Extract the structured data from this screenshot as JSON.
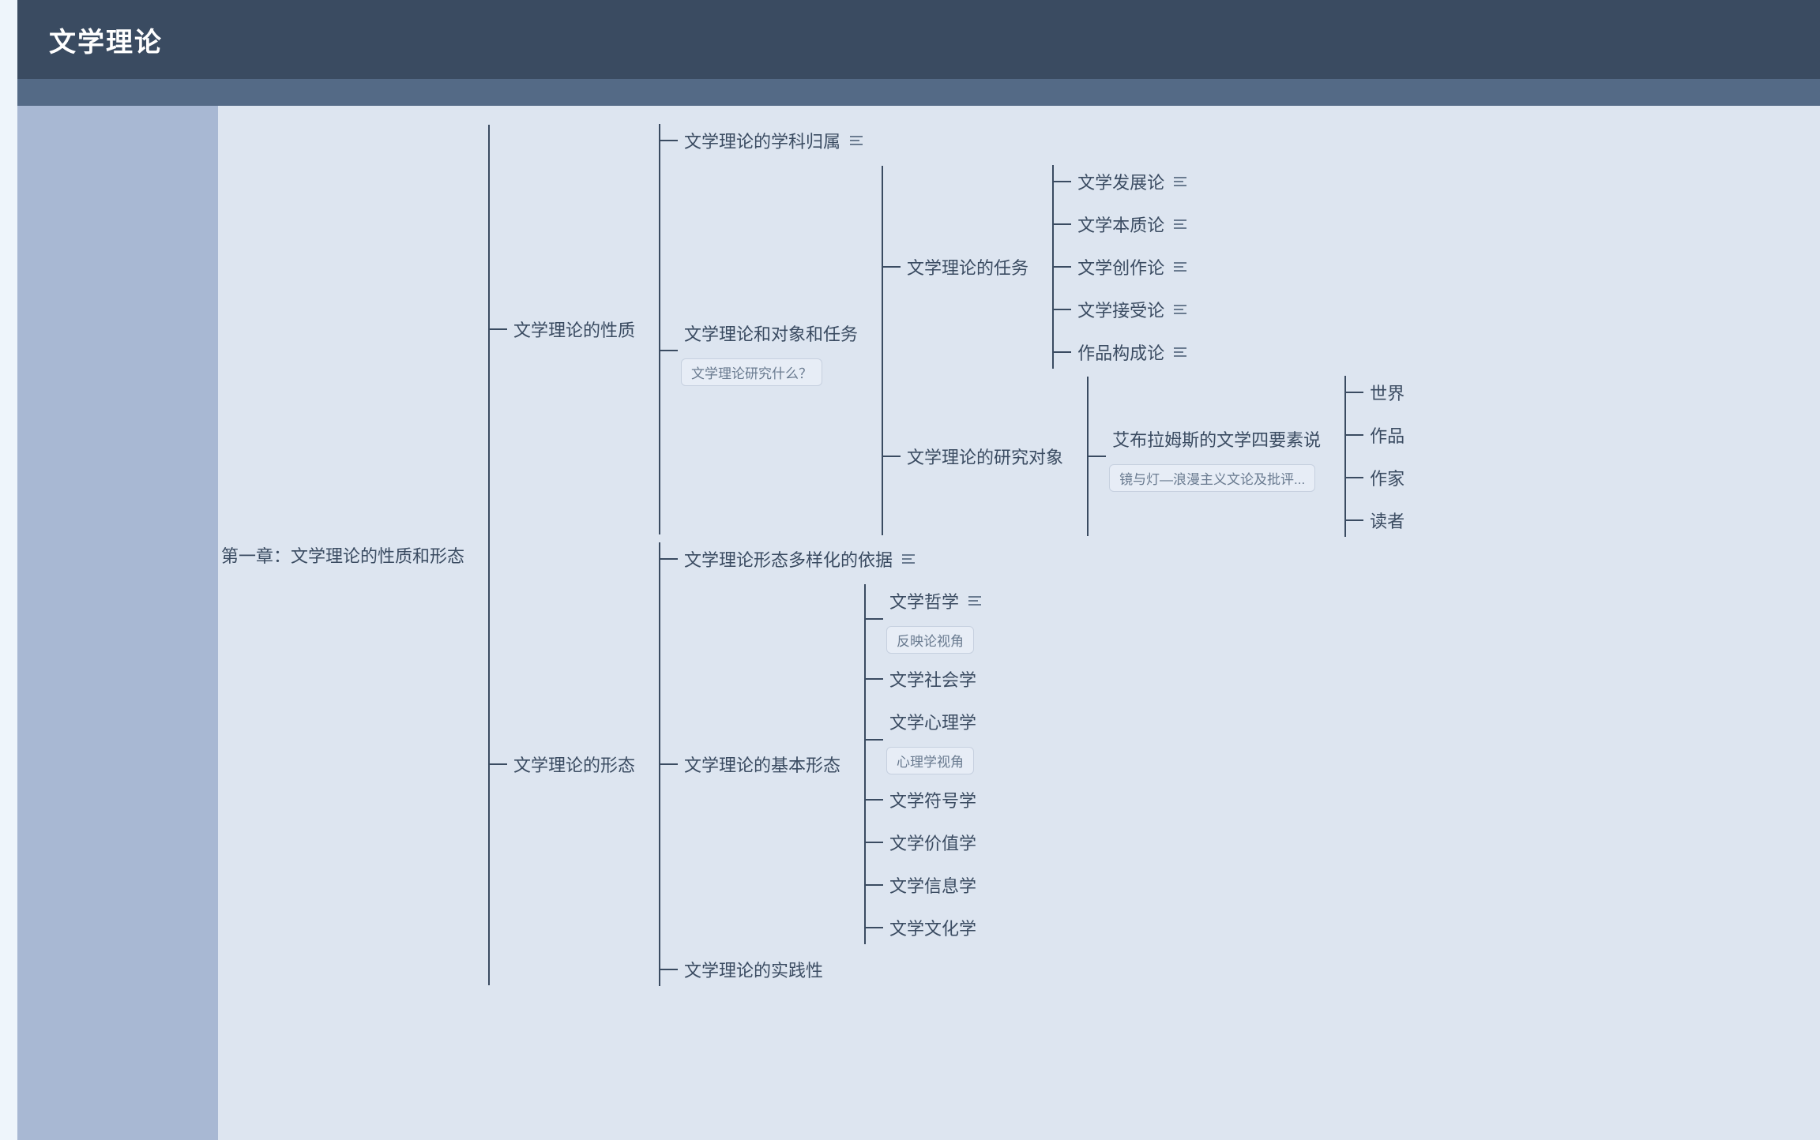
{
  "header": {
    "title": "文学理论"
  },
  "root": {
    "label": "第一章：文学理论的性质和形态",
    "children": [
      {
        "label": "文学理论的性质",
        "children": [
          {
            "label": "文学理论的学科归属",
            "has_note": true
          },
          {
            "label": "文学理论和对象和任务",
            "caption": "文学理论研究什么？",
            "children": [
              {
                "label": "文学理论的任务",
                "children": [
                  {
                    "label": "文学发展论",
                    "has_note": true
                  },
                  {
                    "label": "文学本质论",
                    "has_note": true
                  },
                  {
                    "label": "文学创作论",
                    "has_note": true
                  },
                  {
                    "label": "文学接受论",
                    "has_note": true
                  },
                  {
                    "label": "作品构成论",
                    "has_note": true
                  }
                ]
              },
              {
                "label": "文学理论的研究对象",
                "children": [
                  {
                    "label": "艾布拉姆斯的文学四要素说",
                    "caption": "镜与灯—浪漫主义文论及批评...",
                    "children": [
                      {
                        "label": "世界"
                      },
                      {
                        "label": "作品"
                      },
                      {
                        "label": "作家"
                      },
                      {
                        "label": "读者"
                      }
                    ]
                  }
                ]
              }
            ]
          }
        ]
      },
      {
        "label": "文学理论的形态",
        "children": [
          {
            "label": "文学理论形态多样化的依据",
            "has_note": true
          },
          {
            "label": "文学理论的基本形态",
            "children": [
              {
                "label": "文学哲学",
                "has_note": true,
                "caption": "反映论视角"
              },
              {
                "label": "文学社会学"
              },
              {
                "label": "文学心理学",
                "caption": "心理学视角"
              },
              {
                "label": "文学符号学"
              },
              {
                "label": "文学价值学"
              },
              {
                "label": "文学信息学"
              },
              {
                "label": "文学文化学"
              }
            ]
          },
          {
            "label": "文学理论的实践性"
          }
        ]
      }
    ]
  },
  "icons": {
    "note": "notes-icon"
  }
}
